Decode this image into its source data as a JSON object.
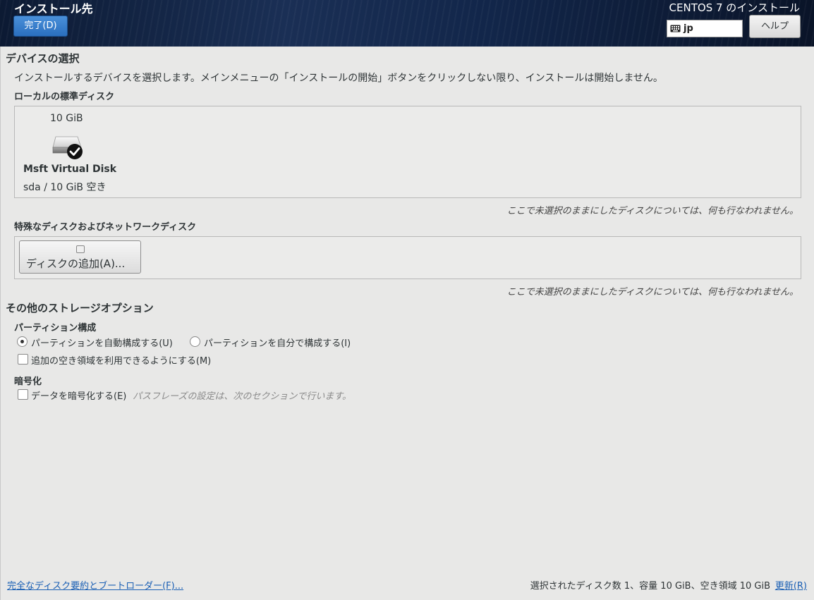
{
  "header": {
    "title": "インストール先",
    "done_button": "完了(D)",
    "product_title": "CENTOS 7 のインストール",
    "keyboard_layout": "jp",
    "help_button": "ヘルプ"
  },
  "device_selection": {
    "heading": "デバイスの選択",
    "description": "インストールするデバイスを選択します。メインメニューの「インストールの開始」ボタンをクリックしない限り、インストールは開始しません。",
    "local_disks_heading": "ローカルの標準ディスク",
    "disks": [
      {
        "size": "10 GiB",
        "name": "Msft Virtual Disk",
        "device": "sda",
        "separator": "/",
        "free": "10 GiB 空き",
        "selected": true
      }
    ],
    "local_note": "ここで未選択のままにしたディスクについては、何も行なわれません。",
    "special_heading": "特殊なディスクおよびネットワークディスク",
    "add_disk_button": "ディスクの追加(A)...",
    "special_note": "ここで未選択のままにしたディスクについては、何も行なわれません。"
  },
  "storage_options": {
    "heading": "その他のストレージオプション",
    "partition_heading": "パーティション構成",
    "auto_partition": "パーティションを自動構成する(U)",
    "manual_partition": "パーティションを自分で構成する(I)",
    "selected_partition_mode": "auto",
    "extra_space": "追加の空き領域を利用できるようにする(M)",
    "extra_space_checked": false,
    "encryption_heading": "暗号化",
    "encrypt_data": "データを暗号化する(E)",
    "encrypt_checked": false,
    "encrypt_hint": "パスフレーズの設定は、次のセクションで行います。"
  },
  "footer": {
    "summary_link": "完全なディスク要約とブートローダー(F)...",
    "summary_text": "選択されたディスク数 1、容量 10 GiB、空き領域 10 GiB",
    "refresh_link": "更新(R)"
  },
  "colors": {
    "header_bg": "#12264a",
    "done_button": "#3a80cc",
    "link": "#1a5fb4",
    "background": "#e8e8e7"
  }
}
